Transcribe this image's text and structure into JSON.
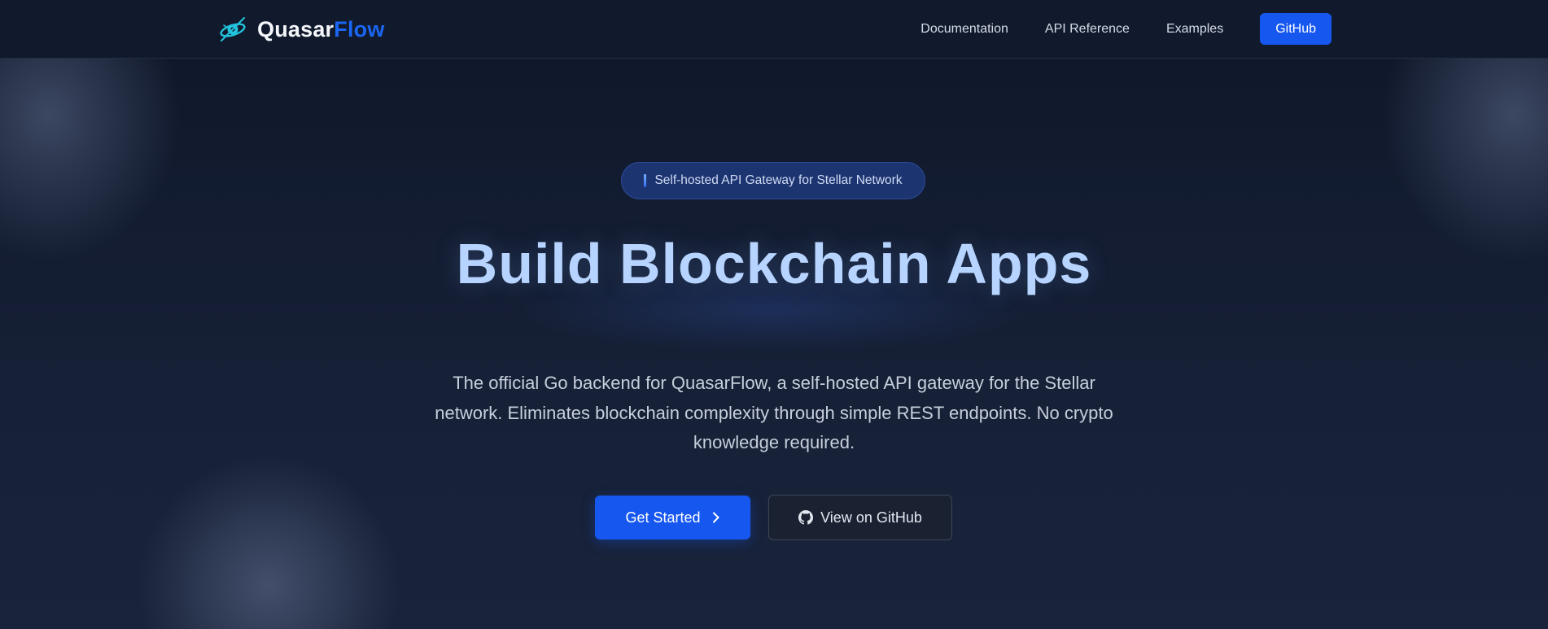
{
  "brand": {
    "name_part1": "Quasar",
    "name_part2": "Flow",
    "icon": "quasar-logo-icon"
  },
  "nav": {
    "links": [
      {
        "label": "Documentation"
      },
      {
        "label": "API Reference"
      },
      {
        "label": "Examples"
      }
    ],
    "cta_label": "GitHub"
  },
  "hero": {
    "badge_text": "Self-hosted API Gateway for Stellar Network",
    "title": "Build Blockchain Apps",
    "description": "The official Go backend for QuasarFlow, a self-hosted API gateway for the Stellar network. Eliminates blockchain complexity through simple REST endpoints. No crypto knowledge required.",
    "primary_button": {
      "label": "Get Started",
      "icon": "chevron-right-icon"
    },
    "secondary_button": {
      "label": "View on GitHub",
      "icon": "github-icon"
    }
  },
  "colors": {
    "accent": "#1657f0",
    "brand_flow": "#1a66f2",
    "title": "#b6d4ff",
    "background": "#141c2f"
  }
}
